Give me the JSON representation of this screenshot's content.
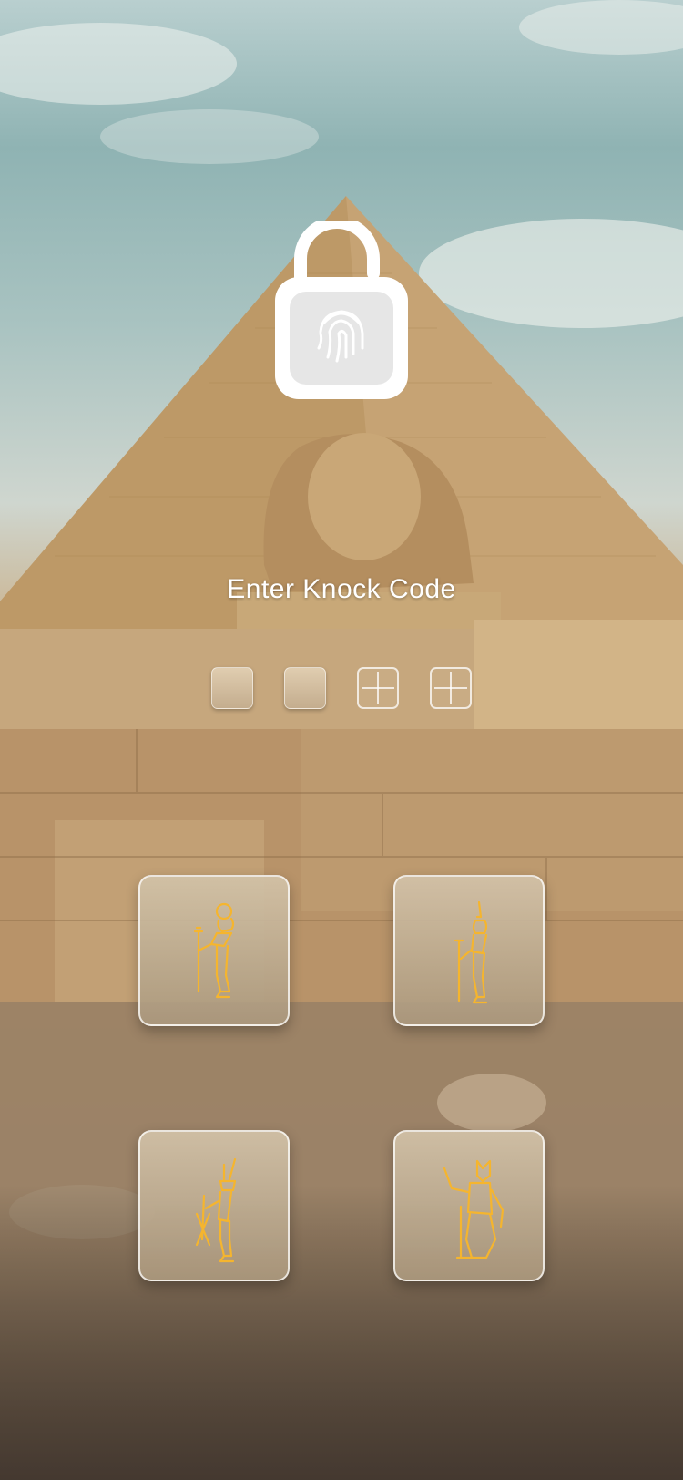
{
  "lock_screen": {
    "title": "Enter Knock Code",
    "code_length": 4,
    "entered_count": 2
  },
  "lock_icon": {
    "name": "fingerprint-padlock-icon"
  },
  "keypad": {
    "keys": [
      {
        "id": "key-ra",
        "icon": "ra-deity-icon"
      },
      {
        "id": "key-maat",
        "icon": "maat-deity-icon"
      },
      {
        "id": "key-horus",
        "icon": "horus-deity-icon"
      },
      {
        "id": "key-anubis",
        "icon": "anubis-deity-icon"
      }
    ]
  },
  "colors": {
    "accent_gold": "#F5B52E",
    "key_fill": "#C0AD8F",
    "text": "#FFFFFF"
  }
}
